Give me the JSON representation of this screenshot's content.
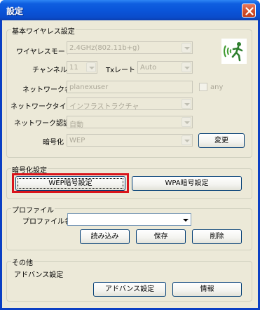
{
  "window": {
    "title": "設定"
  },
  "basic": {
    "legend": "基本ワイヤレス設定",
    "wireless_mode_label": "ワイヤレスモード",
    "wireless_mode_value": "2.4GHz(802.11b+g)",
    "channel_label": "チャンネル",
    "channel_value": "11",
    "txrate_label": "Txレート",
    "txrate_value": "Auto",
    "network_name_label": "ネットワーク名",
    "network_name_value": "planexuser",
    "any_label": "any",
    "network_type_label": "ネットワークタイプ",
    "network_type_value": "インフラストラクチャ",
    "auth_label": "ネットワーク認証",
    "auth_value": "自動",
    "encryption_label": "暗号化",
    "encryption_value": "WEP",
    "change_button": "変更"
  },
  "encryption": {
    "legend": "暗号化設定",
    "wep_button": "WEP暗号設定",
    "wpa_button": "WPA暗号設定"
  },
  "profile": {
    "legend": "プロファイル",
    "name_label": "プロファイル名",
    "name_value": "",
    "load_button": "読み込み",
    "save_button": "保存",
    "delete_button": "削除"
  },
  "other": {
    "legend": "その他",
    "advanced_label": "アドバンス設定",
    "advanced_button": "アドバンス設定",
    "info_button": "情報"
  },
  "colors": {
    "title_bar": "#0a55da",
    "dialog_bg": "#ece9d8",
    "highlight_box": "#d9141b",
    "logo_green": "#3f9a2f"
  },
  "icons": {
    "close": "close-icon",
    "wireless_logo": "wireless-runner-icon"
  }
}
